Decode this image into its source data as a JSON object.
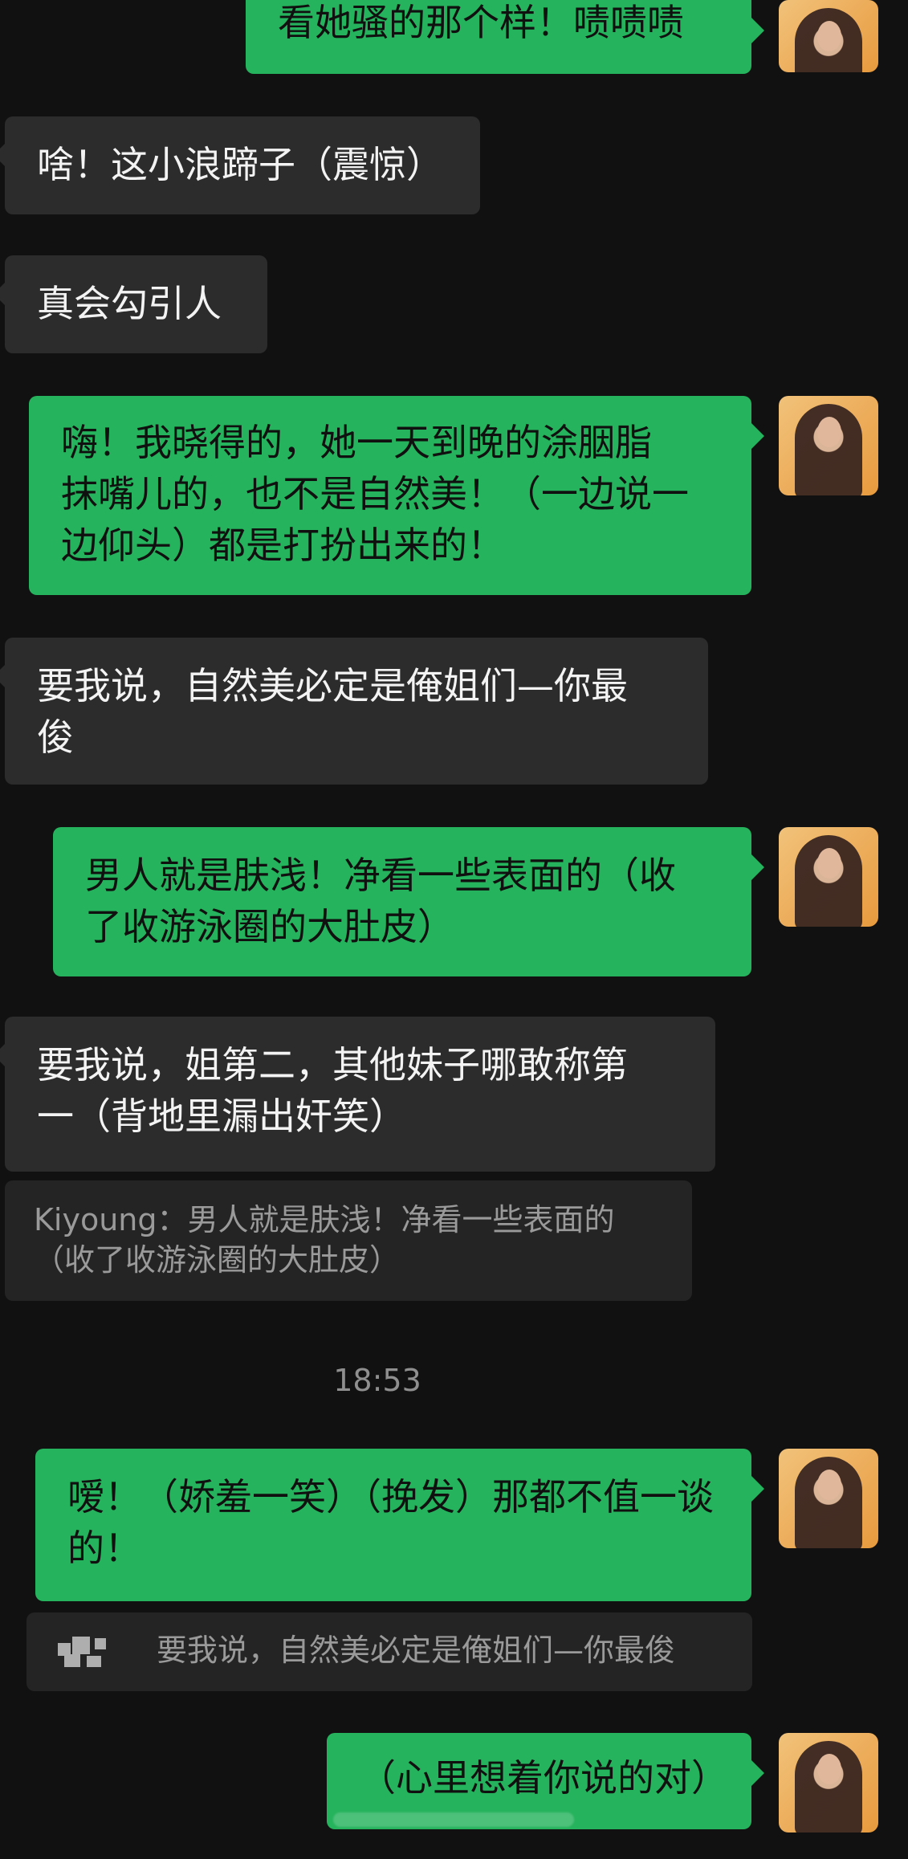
{
  "messages": [
    {
      "id": "m1",
      "side": "out",
      "text": "看她骚的那个样！啧啧啧"
    },
    {
      "id": "m2",
      "side": "in",
      "text": "啥！这小浪蹄子（震惊）"
    },
    {
      "id": "m3",
      "side": "in",
      "text": "真会勾引人"
    },
    {
      "id": "m4",
      "side": "out",
      "text": "嗨！我晓得的，她一天到晚的涂胭脂\n抹嘴儿的，也不是自然美！（一边说一\n边仰头）都是打扮出来的！"
    },
    {
      "id": "m5",
      "side": "in",
      "text": "要我说，自然美必定是俺姐们—你最\n俊"
    },
    {
      "id": "m6",
      "side": "out",
      "text": "男人就是肤浅！净看一些表面的（收\n了收游泳圈的大肚皮）"
    },
    {
      "id": "m7",
      "side": "in",
      "text": "要我说，姐第二，其他妹子哪敢称第\n一（背地里漏出奸笑）"
    },
    {
      "id": "m8",
      "side": "quote",
      "text": "Kiyoung：男人就是肤浅！净看一些表面的\n（收了收游泳圈的大肚皮）"
    },
    {
      "id": "m9",
      "side": "time",
      "text": "18:53"
    },
    {
      "id": "m10",
      "side": "out",
      "text": "嗳！（娇羞一笑）（挽发）那都不值一谈\n的！"
    },
    {
      "id": "m11",
      "side": "quote",
      "text": "要我说，自然美必定是俺姐们—你最俊"
    },
    {
      "id": "m12",
      "side": "out",
      "text": "（心里想着你说的对）"
    }
  ],
  "colors": {
    "background": "#111111",
    "incoming_bubble": "#2c2c2c",
    "outgoing_bubble": "#26b35d",
    "quote_bg": "#242424",
    "timestamp": "#8f8f8f"
  }
}
